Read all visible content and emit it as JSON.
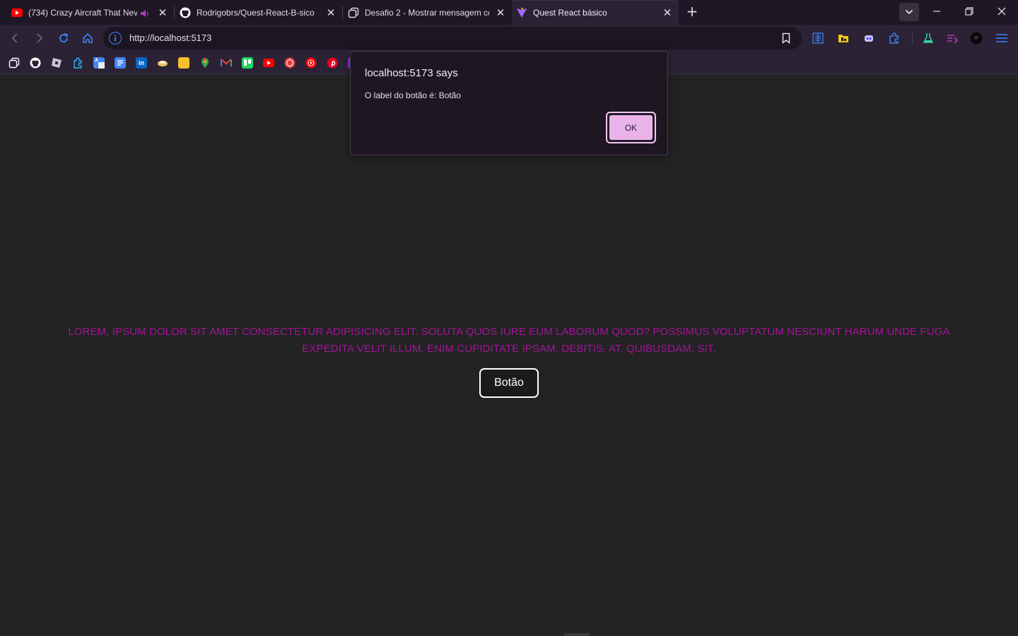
{
  "browser": {
    "tabs": [
      {
        "title": "(734) Crazy Aircraft That Neve",
        "icon": "youtube-icon",
        "audio": true
      },
      {
        "title": "Rodrigobrs/Quest-React-B-sico",
        "icon": "github-icon"
      },
      {
        "title": "Desafio 2 - Mostrar mensagem co",
        "icon": "tab-group-icon"
      },
      {
        "title": "Quest React básico",
        "icon": "vite-icon",
        "active": true
      }
    ],
    "close_glyph": "✕",
    "new_tab_glyph": "+",
    "url": "http://localhost:5173"
  },
  "dialog": {
    "title": "localhost:5173 says",
    "message": "O label do botão é: Botão",
    "ok_label": "OK"
  },
  "page": {
    "paragraph": "LOREM, IPSUM DOLOR SIT AMET CONSECTETUR ADIPISICING ELIT. SOLUTA QUOS IURE EUM LABORUM QUOD? POSSIMUS VOLUPTATUM NESCIUNT HARUM UNDE FUGA EXPEDITA VELIT ILLUM, ENIM CUPIDITATE IPSAM. DEBITIS, AT. QUIBUSDAM, SIT.",
    "button_label": "Botão"
  },
  "colors": {
    "background": "#232323",
    "paragraph_text": "#a3139a",
    "chrome": "#2c2235",
    "ok_button": "#e9b3ea"
  }
}
